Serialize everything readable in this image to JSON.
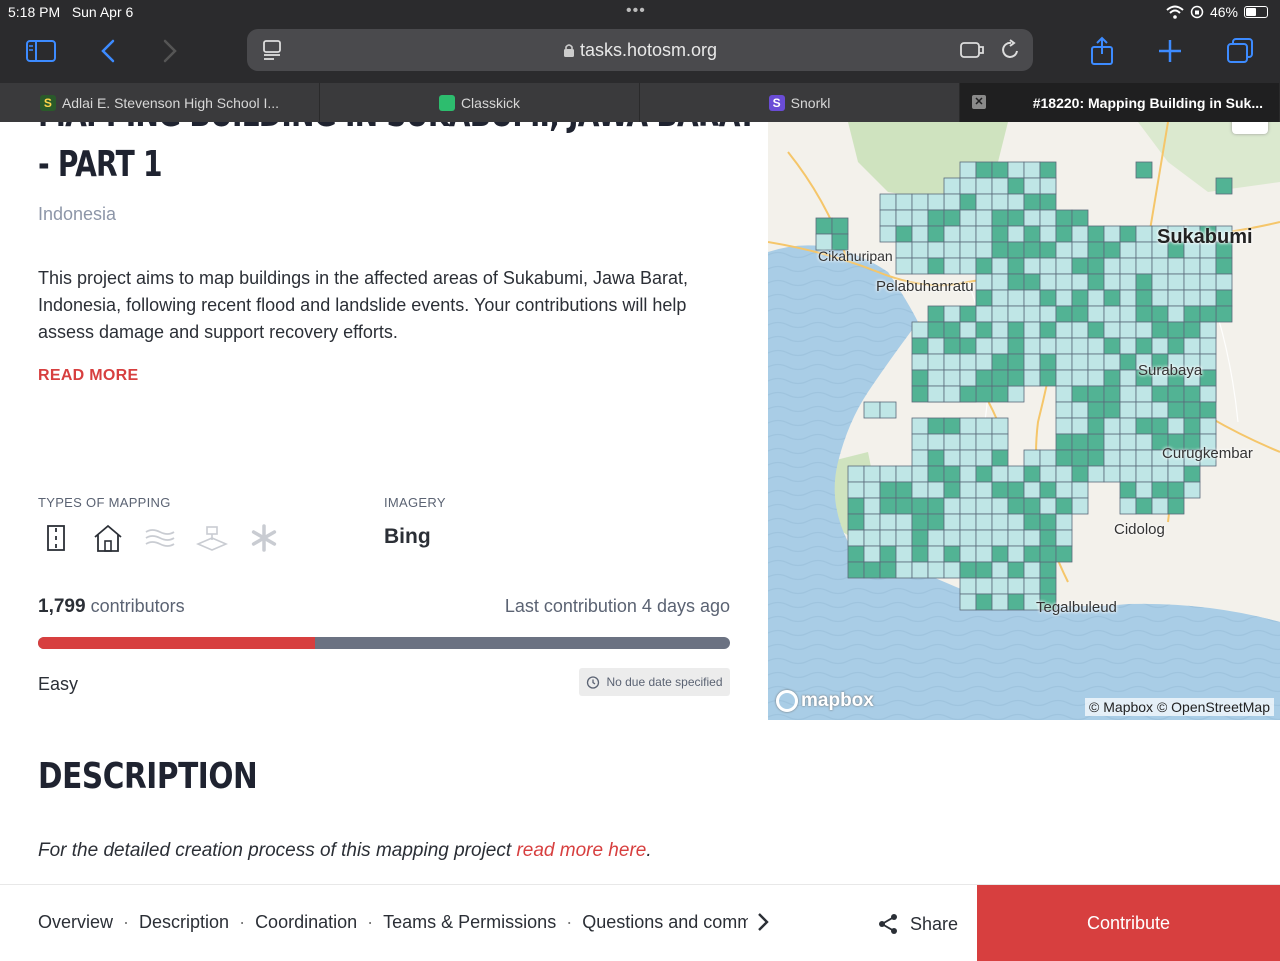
{
  "status_bar": {
    "time": "5:18 PM",
    "date": "Sun Apr 6",
    "battery": "46%"
  },
  "browser": {
    "url": "tasks.hotosm.org",
    "tabs": [
      {
        "label": "Adlai E. Stevenson High School I...",
        "favicon_color": "#2a5a2a"
      },
      {
        "label": "Classkick",
        "favicon_color": "#2dbd6e"
      },
      {
        "label": "Snorkl",
        "favicon_color": "#6a4cd6"
      },
      {
        "label": "#18220: Mapping Building in Suk..."
      }
    ]
  },
  "project": {
    "title_line1": "MAPPING BUILDING IN SUKABUMI, JAWA BARAT",
    "title_line2": "- PART 1",
    "country": "Indonesia",
    "summary": "This project aims to map buildings in the affected areas of Sukabumi, Jawa Barat, Indonesia, following recent flood and landslide events. Your contributions will help assess damage and support recovery efforts.",
    "read_more": "READ MORE",
    "types_label": "TYPES OF MAPPING",
    "mapping_types": [
      "roads-icon",
      "buildings-icon",
      "waterways-icon",
      "landuse-icon",
      "other-icon"
    ],
    "imagery_label": "IMAGERY",
    "imagery": "Bing",
    "contributors_count": "1,799",
    "contributors_label": "contributors",
    "last_contribution": "Last contribution 4 days ago",
    "progress_fraction": 0.4,
    "difficulty": "Easy",
    "due_date": "No due date specified"
  },
  "description": {
    "title": "DESCRIPTION",
    "text_before": "For the detailed creation process of this mapping project ",
    "link": "read more here",
    "text_after": "."
  },
  "map": {
    "cities": {
      "sukabumi": "Sukabumi",
      "cikahuripan": "Cikahuripan",
      "pelabuhanratu": "Pelabuhanratu",
      "surabaya": "Surabaya",
      "curugkembar": "Curugkembar",
      "cidolog": "Cidolog",
      "tegalbuleud": "Tegalbuleud"
    },
    "logo": "mapbox",
    "attribution": "© Mapbox © OpenStreetMap",
    "colors": {
      "mapped": "#52b394",
      "unmapped": "#bfe6e6",
      "water": "#a9cde6",
      "land": "#f3f1eb"
    }
  },
  "bottom_nav": {
    "links": [
      "Overview",
      "Description",
      "Coordination",
      "Teams & Permissions",
      "Questions and comments"
    ],
    "share": "Share",
    "contribute": "Contribute"
  }
}
